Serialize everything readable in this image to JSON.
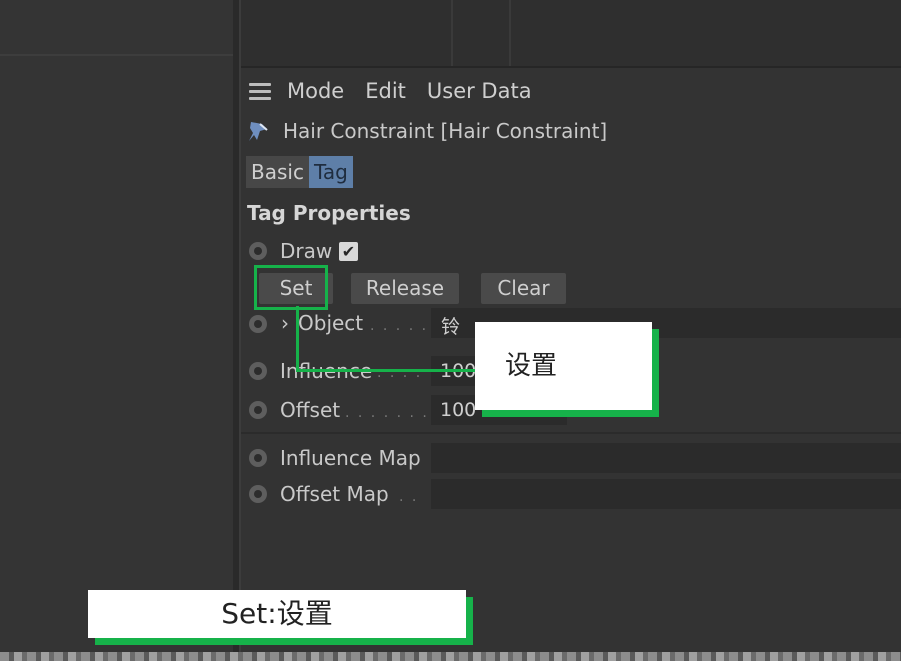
{
  "menu": {
    "items": [
      "Mode",
      "Edit",
      "User Data"
    ]
  },
  "object": {
    "title": "Hair Constraint [Hair Constraint]"
  },
  "tabs": [
    {
      "label": "Basic",
      "active": false
    },
    {
      "label": "Tag",
      "active": true
    }
  ],
  "section": {
    "title": "Tag Properties"
  },
  "draw": {
    "label": "Draw",
    "checked": true
  },
  "buttons": {
    "set": "Set",
    "release": "Release",
    "clear": "Clear"
  },
  "properties": {
    "object": {
      "label": "Object",
      "dots": ". . . . .",
      "arrow": "›",
      "value": "铃"
    },
    "influence": {
      "label": "Influence",
      "dots": ". . . .",
      "value": "100"
    },
    "offset": {
      "label": "Offset",
      "dots": ". . . . . . .",
      "value": "100 %"
    },
    "influence_map": {
      "label": "Influence Map"
    },
    "offset_map": {
      "label": "Offset Map",
      "dots": ". ."
    }
  },
  "annotations": {
    "callout": "设置",
    "caption": "Set:设置"
  },
  "colors": {
    "accent": "#16b24a",
    "tab_active": "#5e7fa8",
    "background": "#333333"
  },
  "icons": {
    "menu": "hamburger-icon",
    "tag": "pin-icon",
    "check": "checkmark-icon"
  }
}
